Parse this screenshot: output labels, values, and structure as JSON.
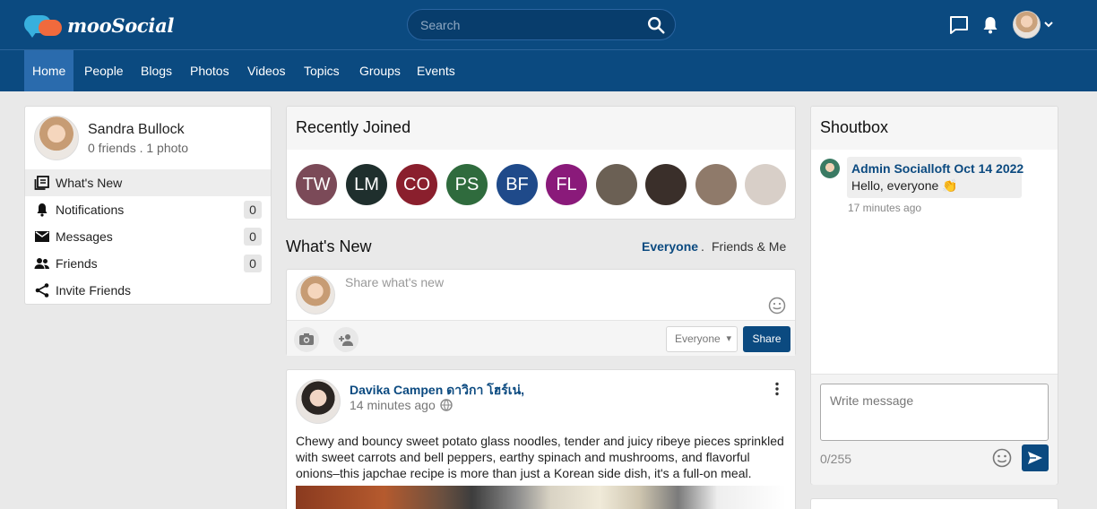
{
  "brand": {
    "name": "mooSocial"
  },
  "search": {
    "placeholder": "Search"
  },
  "nav": {
    "items": [
      "Home",
      "People",
      "Blogs",
      "Photos",
      "Videos",
      "Topics",
      "Groups",
      "Events"
    ],
    "active": "Home"
  },
  "header_icons": [
    "chat-icon",
    "bell-icon",
    "user-avatar",
    "chevron-down-icon"
  ],
  "profile": {
    "name": "Sandra Bullock",
    "meta": "0 friends . 1 photo",
    "menu": [
      {
        "label": "What's New",
        "icon": "newsfeed-icon",
        "count": null,
        "active": true
      },
      {
        "label": "Notifications",
        "icon": "bell-icon",
        "count": "0"
      },
      {
        "label": "Messages",
        "icon": "envelope-icon",
        "count": "0"
      },
      {
        "label": "Friends",
        "icon": "people-icon",
        "count": "0"
      },
      {
        "label": "Invite Friends",
        "icon": "share-icon",
        "count": null
      }
    ]
  },
  "recently_joined": {
    "title": "Recently Joined",
    "members": [
      {
        "initials": "TW",
        "color": "#7b4a58"
      },
      {
        "initials": "LM",
        "color": "#1f2f2d"
      },
      {
        "initials": "CO",
        "color": "#8a1f2d"
      },
      {
        "initials": "PS",
        "color": "#2f6b3d"
      },
      {
        "initials": "BF",
        "color": "#1f4a8a"
      },
      {
        "initials": "FL",
        "color": "#8a1a7a"
      },
      {
        "initials": "",
        "color": "#6b6054"
      },
      {
        "initials": "",
        "color": "#3a2f2a"
      },
      {
        "initials": "",
        "color": "#8f7a6a"
      },
      {
        "initials": "",
        "color": "#d8cfc8"
      }
    ]
  },
  "feed": {
    "title": "What's New",
    "filters": [
      "Everyone",
      "Friends & Me"
    ],
    "filter_separator": ".",
    "active_filter": "Everyone"
  },
  "composer": {
    "placeholder": "Share what's new",
    "privacy": "Everyone",
    "share_label": "Share"
  },
  "post": {
    "author": "Davika Campen ดาวิกา โฮร์เน่,",
    "time": "14 minutes ago",
    "text": "Chewy and bouncy sweet potato glass noodles, tender and juicy ribeye pieces sprinkled with sweet carrots and bell peppers, earthy spinach and mushrooms, and flavorful onions–this japchae recipe is more than just a Korean side dish, it's a full-on meal."
  },
  "shoutbox": {
    "title": "Shoutbox",
    "messages": [
      {
        "author": "Admin Socialloft",
        "date": "Oct 14 2022",
        "text": "Hello, everyone 👏",
        "time": "17 minutes ago"
      }
    ],
    "placeholder": "Write message",
    "counter": "0/255"
  },
  "colors": {
    "primary": "#0b4a80",
    "active_nav": "#2a6bad",
    "background": "#e9e9e9"
  }
}
